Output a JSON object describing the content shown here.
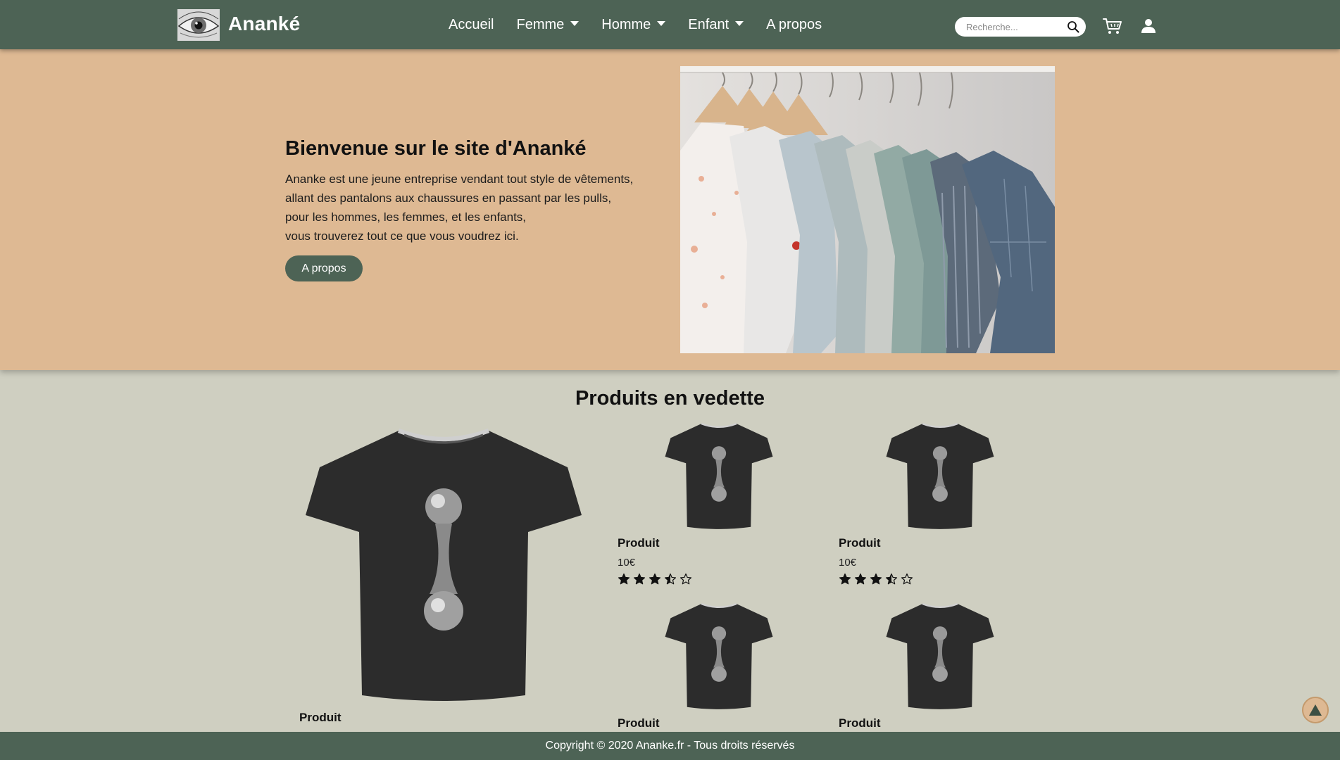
{
  "navbar": {
    "brand": "Ananké",
    "logo_icon": "eye-logo-icon",
    "links": [
      {
        "label": "Accueil",
        "dropdown": false
      },
      {
        "label": "Femme",
        "dropdown": true
      },
      {
        "label": "Homme",
        "dropdown": true
      },
      {
        "label": "Enfant",
        "dropdown": true
      },
      {
        "label": "A propos",
        "dropdown": false
      }
    ],
    "search_placeholder": "Recherche...",
    "search_icon": "search-icon",
    "cart_icon": "cart-icon",
    "user_icon": "user-icon",
    "colors": {
      "navbar": "#4d6355",
      "text": "#ffffff"
    }
  },
  "hero": {
    "title": "Bienvenue sur le site d'Ananké",
    "lines": [
      "Ananke est une jeune entreprise vendant tout style de vêtements,",
      "allant des pantalons aux chaussures en passant par les pulls,",
      "pour les hommes, les femmes, et les enfants,",
      "vous trouverez tout ce que vous voudrez ici."
    ],
    "button_label": "A propos",
    "colors": {
      "background": "#deb993",
      "button": "#4d6355"
    }
  },
  "featured": {
    "title": "Produits en vedette",
    "products": [
      {
        "name": "Produit",
        "price": "",
        "rating": null
      },
      {
        "name": "Produit",
        "price": "10€",
        "rating": 3.5
      },
      {
        "name": "Produit",
        "price": "10€",
        "rating": 3.5
      },
      {
        "name": "Produit",
        "price": "",
        "rating": null
      },
      {
        "name": "Produit",
        "price": "",
        "rating": null
      }
    ],
    "max_rating": 5
  },
  "back_to_top_icon": "arrow-up-icon",
  "footer": {
    "text": "Copyright © 2020 Ananke.fr - Tous droits réservés"
  },
  "page_background": "#cfcfc1"
}
